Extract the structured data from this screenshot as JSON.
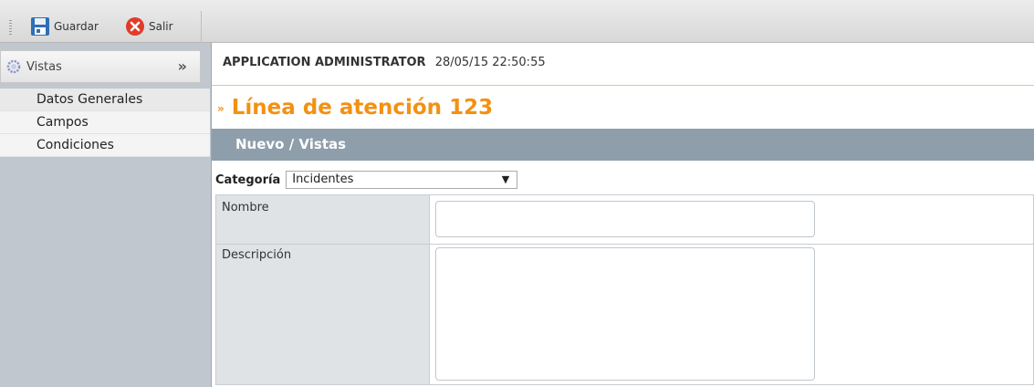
{
  "toolbar": {
    "save_label": "Guardar",
    "exit_label": "Salir"
  },
  "sidebar": {
    "section_title": "Vistas",
    "items": [
      {
        "label": "Datos Generales"
      },
      {
        "label": "Campos"
      },
      {
        "label": "Condiciones"
      }
    ]
  },
  "header": {
    "user": "APPLICATION ADMINISTRATOR",
    "timestamp": "28/05/15 22:50:55",
    "page_title": "Línea de atención 123",
    "section": "Nuevo / Vistas"
  },
  "form": {
    "category_label": "Categoría",
    "category_value": "Incidentes",
    "name_label": "Nombre",
    "name_value": "",
    "description_label": "Descripción",
    "description_value": ""
  },
  "colors": {
    "title_orange": "#f39112",
    "section_bar": "#8e9eab",
    "sidebar_bg": "#c0c7ce"
  }
}
